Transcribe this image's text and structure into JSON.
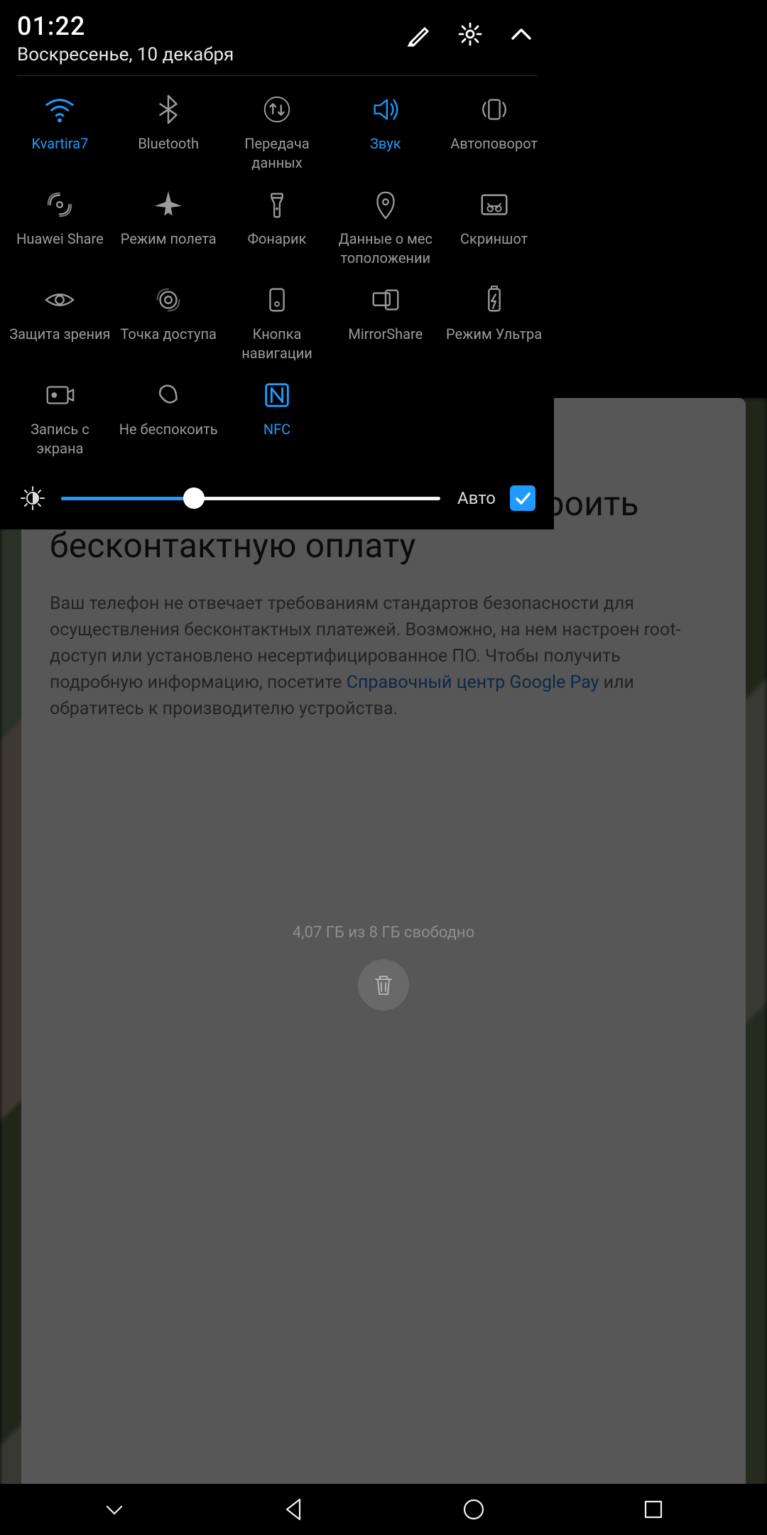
{
  "status": {
    "time": "01:22",
    "date": "Воскресенье, 10 декабря"
  },
  "colors": {
    "accent": "#1f9aff",
    "muted": "#9b9b9b"
  },
  "tiles": [
    {
      "id": "wifi",
      "label": "Kvartira7",
      "active": true
    },
    {
      "id": "bluetooth",
      "label": "Bluetooth",
      "active": false
    },
    {
      "id": "data",
      "label": "Передача данных",
      "active": false
    },
    {
      "id": "sound",
      "label": "Звук",
      "active": true
    },
    {
      "id": "rotate",
      "label": "Автоповорот",
      "active": false
    },
    {
      "id": "share",
      "label": "Huawei Share",
      "active": false
    },
    {
      "id": "airplane",
      "label": "Режим полета",
      "active": false
    },
    {
      "id": "torch",
      "label": "Фонарик",
      "active": false
    },
    {
      "id": "location",
      "label": "Данные о мес тоположении",
      "active": false
    },
    {
      "id": "screenshot",
      "label": "Скриншот",
      "active": false
    },
    {
      "id": "eyecare",
      "label": "Защита зрения",
      "active": false
    },
    {
      "id": "hotspot",
      "label": "Точка доступа",
      "active": false
    },
    {
      "id": "navbtn",
      "label": "Кнопка навигации",
      "active": false
    },
    {
      "id": "mirror",
      "label": "MirrorShare",
      "active": false
    },
    {
      "id": "ultra",
      "label": "Режим Ультра",
      "active": false
    },
    {
      "id": "record",
      "label": "Запись с экрана",
      "active": false
    },
    {
      "id": "dnd",
      "label": "Не беспокоить",
      "active": false
    },
    {
      "id": "nfc",
      "label": "NFC",
      "active": true
    }
  ],
  "brightness": {
    "percent": 35,
    "auto_label": "Авто",
    "auto_checked": true
  },
  "background": {
    "storage_text": "4,07 ГБ из 8 ГБ свободно",
    "card": {
      "title": "На этом телефоне нельзя настроить бесконтактную оплату",
      "body_pre": "Ваш телефон не отвечает требованиям стандартов безопасности для осуществления бесконтактных платежей. Возможно, на нем настроен root-доступ или установлено несертифицированное ПО. Чтобы получить подробную информацию, посетите ",
      "link": "Справочный центр Google Pay",
      "body_post": " или обратитесь к производителю устройства."
    }
  }
}
